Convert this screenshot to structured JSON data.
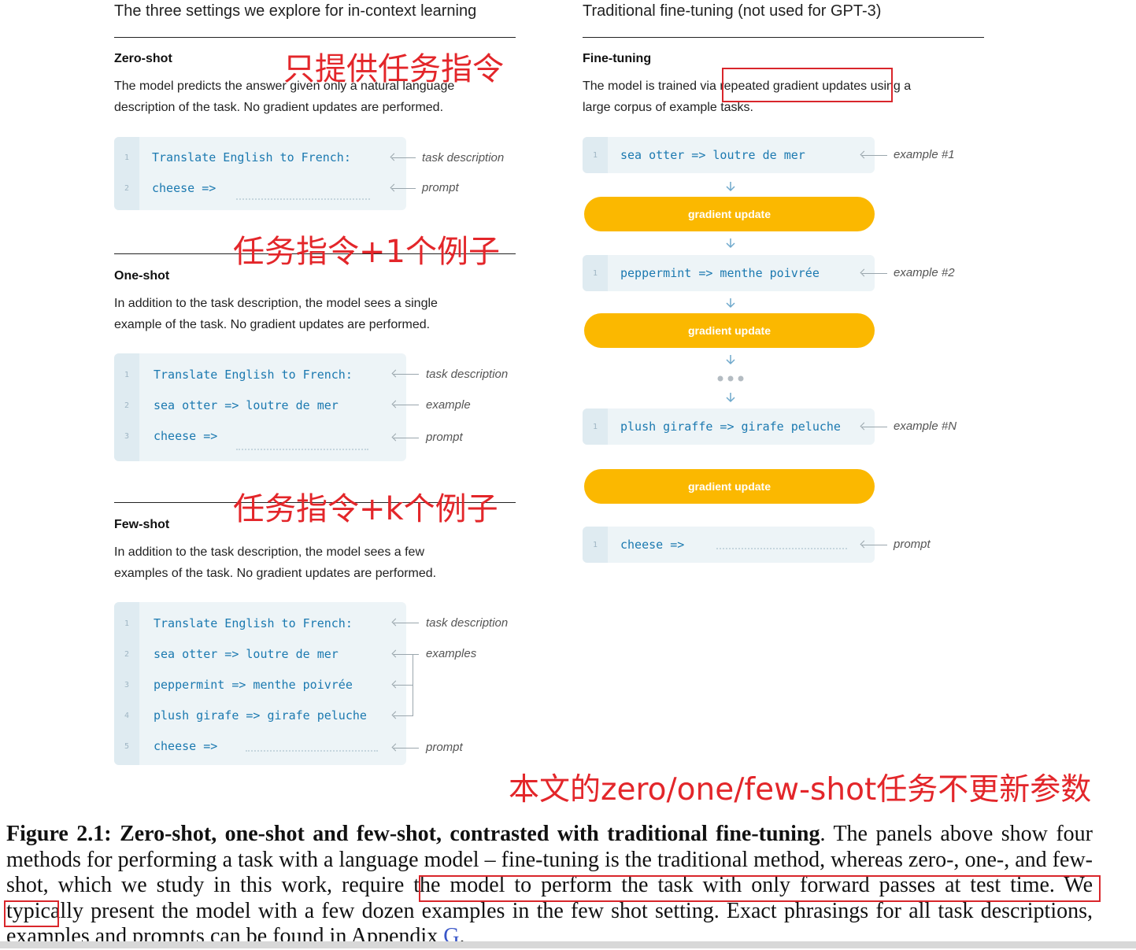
{
  "left_panel": {
    "title": "The three settings we explore for in-context learning",
    "zero_shot": {
      "heading": "Zero-shot",
      "desc_line1": "The model predicts the answer given only a natural language",
      "desc_line2": "description of the task. No gradient updates are performed.",
      "lines": [
        {
          "num": "1",
          "code": "Translate English to French:",
          "label": "task description"
        },
        {
          "num": "2",
          "code": "cheese =>",
          "label": "prompt"
        }
      ]
    },
    "one_shot": {
      "heading": "One-shot",
      "desc_line1": "In addition to the task description, the model sees a single",
      "desc_line2": "example of the task. No gradient updates are performed.",
      "lines": [
        {
          "num": "1",
          "code": "Translate English to French:",
          "label": "task description"
        },
        {
          "num": "2",
          "code": "sea otter => loutre de mer",
          "label": "example"
        },
        {
          "num": "3",
          "code": "cheese =>",
          "label": "prompt"
        }
      ]
    },
    "few_shot": {
      "heading": "Few-shot",
      "desc_line1": "In addition to the task description, the model sees a few",
      "desc_line2": "examples of the task. No gradient updates are performed.",
      "lines": [
        {
          "num": "1",
          "code": "Translate English to French:",
          "label": "task description"
        },
        {
          "num": "2",
          "code": "sea otter => loutre de mer",
          "label": "examples"
        },
        {
          "num": "3",
          "code": "peppermint => menthe poivrée",
          "label": ""
        },
        {
          "num": "4",
          "code": "plush girafe => girafe peluche",
          "label": ""
        },
        {
          "num": "5",
          "code": "cheese =>",
          "label": "prompt"
        }
      ]
    }
  },
  "right_panel": {
    "title": "Traditional fine-tuning (not used for GPT-3)",
    "heading": "Fine-tuning",
    "desc_part1": "The model is trained via",
    "desc_highlight": "repeated gradient updates",
    "desc_part2": "using a",
    "desc_line2": "large corpus of example tasks.",
    "blocks": [
      {
        "num": "1",
        "code": "sea otter => loutre de mer",
        "label": "example #1"
      },
      {
        "num": "1",
        "code": "peppermint => menthe poivrée",
        "label": "example #2"
      },
      {
        "num": "1",
        "code": "plush giraffe => girafe peluche",
        "label": "example #N"
      },
      {
        "num": "1",
        "code": "cheese =>",
        "label": "prompt"
      }
    ],
    "gradient_label": "gradient update"
  },
  "annotations": {
    "zero": "只提供任务指令",
    "one": "任务指令+1个例子",
    "few": "任务指令+k个例子",
    "note": "本文的zero/one/few-shot任务不更新参数"
  },
  "caption": {
    "label": "Figure 2.1:",
    "bold": "Zero-shot, one-shot and few-shot, contrasted with traditional fine-tuning",
    "text1": ". The panels above show four methods for performing a task with a language model – fine-tuning is the traditional method, whereas zero-, one-, and few-shot, which we study in this work, ",
    "highlight": "require the model to perform the task with only forward passes at test time.",
    "text2": " We typically present the model with a few dozen examples in the few shot setting. Exact phrasings for all task descriptions, examples and prompts can be found in Appendix ",
    "link": "G",
    "end": "."
  }
}
